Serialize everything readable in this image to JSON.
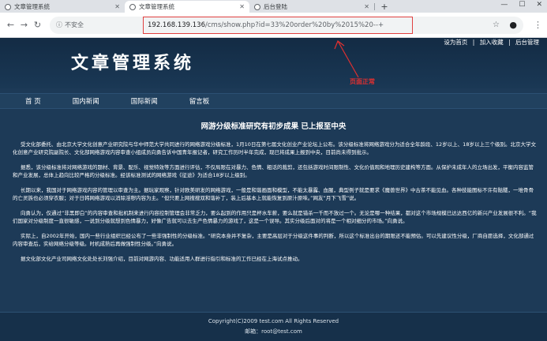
{
  "browser": {
    "tabs": [
      {
        "title": "文章管理系统",
        "active": false
      },
      {
        "title": "文章管理系统",
        "active": true
      },
      {
        "title": "后台登陆",
        "active": false
      }
    ],
    "new_tab_icon": "plus-icon",
    "insecure_label": "不安全",
    "url_host": "192.168.139.136",
    "url_path": "/cms/show.php?id=33%20order%20by%2015%20--+"
  },
  "site": {
    "title": "文章管理系统",
    "top_links": [
      "设为首页",
      "加入收藏",
      "后台管理"
    ],
    "top_link_sep": "|",
    "annotation": "页面正常",
    "annotation_color": "#e03030",
    "nav": [
      "首 页",
      "国内新闻",
      "国际新闻",
      "留言板"
    ]
  },
  "article": {
    "title": "网游分级标准研究有初步成果 已上报至中央",
    "paragraphs": [
      "受文化部委托、由北京大学文化创意产业研究院与华中师范大学共同进行的网络游戏分级标准，1月10日在第七届文化创业产业论坛上公布。该分级标准将网络游戏分为适合全年龄段、12岁以上、18岁以上三个级别。北京大学文化创意产业研究院副院长、文化部网络游戏内容审查小组成员向勇告诉中国青年报记者，研究工作历时半年完成，现已将成果上报到中央，目前尚未得到批示。",
      "据悉，该分级标准将对网络游戏的题材、背景、配乐、视觉特效等方面进行评估，不仅局限在对暴力、色情、粗话的裁剪，还包括游戏时间限制性、文化价值观和地理历史建构等方面。从保护未成年人的立场出发，平衡内容监管和产业发展，总体上趋向比较严格的分级标准。经该标准测试的网络游戏《征途》为适合18岁以上级别。",
      "长期以来，我国对于网络游戏内容的管理以审查为主。据玩家观察，针对欧美研发的网络游戏，一般是和谐画面和模型，不能太暴露、血腥，典型例子就是要求《魔兽世界》中古茶不能见血。各种技能图标不许有骷髅，一堆骨骨的亡灵族也必须穿衣服；对于日韩网络游戏以消除淫秽内容为主。“但只要上网搜搜双和谐补丁，装上后基本上就能恢复到原汁原味。”网友“月下飞雪”说。",
      "向勇认为，仅通过“非黑即白”的内容审查和批机制来进行内容控制管理会非常乏力，要么起到的作用只是杯水车薪，要么就是错杀一千而不放过一个。无论是哪一种结果，都对这个市场规模已达达西亿的新兴产业发展很不利。“我们国家对分级制度一直很敏感，一说到分级就想到色情暴力，好像广告就可以去生产色情暴力的游戏了，这是一个误导。其实分级后面对的将是一个相对细分的市场。”向勇说。",
      "实际上，自2002年开始，国内一些行业组织已经公布了一些非强制性的分级标准。“研究本身并不复杂，主要是高层对于分级这件事的判断，所以这个标准出台的期限还不能预估。可以先建议性分级，厂商自愿选择，文化部通过内容审查后，实给网络分级等级。时机成熟后再做强制性分级。”向勇说。",
      "据文化部文化产业司网络文化处处长刘强介绍，目前对网游内容、功能适用人群进行指引和标准的工作已经在上海试点推动。"
    ]
  },
  "footer": {
    "copyright": "Copyright(C)2009 test.com All Rights Reserved",
    "email": "邮箱：root@test.com"
  }
}
